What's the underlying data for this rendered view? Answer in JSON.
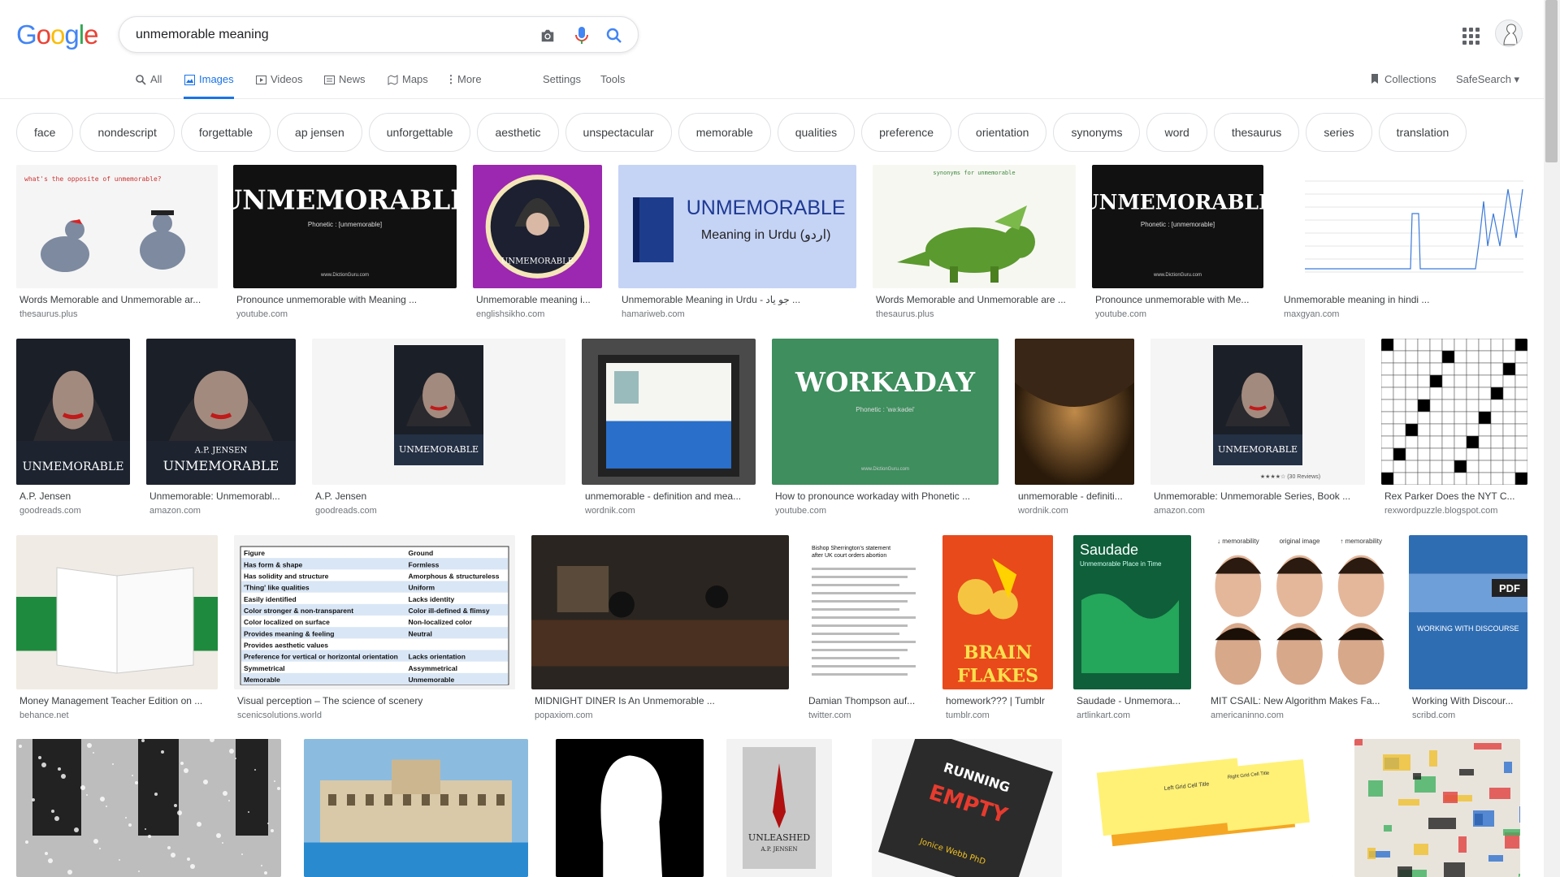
{
  "brand": {
    "letters": [
      "G",
      "o",
      "o",
      "g",
      "l",
      "e"
    ],
    "colors": [
      "#4285f4",
      "#ea4335",
      "#fbbc05",
      "#4285f4",
      "#34a853",
      "#ea4335"
    ]
  },
  "search": {
    "query": "unmemorable meaning",
    "placeholder": "",
    "icons": [
      "camera-icon",
      "microphone-icon",
      "search-icon"
    ]
  },
  "tabs": [
    {
      "label": "All",
      "icon": "search-icon",
      "active": false
    },
    {
      "label": "Images",
      "icon": "image-icon",
      "active": true
    },
    {
      "label": "Videos",
      "icon": "video-icon",
      "active": false
    },
    {
      "label": "News",
      "icon": "news-icon",
      "active": false
    },
    {
      "label": "Maps",
      "icon": "map-icon",
      "active": false
    },
    {
      "label": "More",
      "icon": "more-vert-icon",
      "active": false
    }
  ],
  "tools": {
    "settings": "Settings",
    "tools": "Tools",
    "collections": "Collections",
    "safesearch": "SafeSearch ▾"
  },
  "chips": [
    "face",
    "nondescript",
    "forgettable",
    "ap jensen",
    "unforgettable",
    "aesthetic",
    "unspectacular",
    "memorable",
    "qualities",
    "preference",
    "orientation",
    "synonyms",
    "word",
    "thesaurus",
    "series",
    "translation"
  ],
  "results": [
    {
      "title": "Words Memorable and Unmemorable ar...",
      "source": "thesaurus.plus",
      "thumb": {
        "type": "birds",
        "bg": "#f5f5f5",
        "text": "what's the opposite of unmemorable?"
      }
    },
    {
      "title": "Pronounce unmemorable with Meaning ...",
      "source": "youtube.com",
      "thumb": {
        "type": "title",
        "bg": "#111111",
        "text": "UNMEMORABLE",
        "sub": "Phonetic : [unmemorable]",
        "fg": "#ffffff"
      }
    },
    {
      "title": "Unmemorable meaning i...",
      "source": "englishsikho.com",
      "thumb": {
        "type": "circle",
        "bg": "#9c27b0",
        "text": "UNMEMORABLE"
      }
    },
    {
      "title": "Unmemorable Meaning in Urdu - جو یاد ...",
      "source": "hamariweb.com",
      "thumb": {
        "type": "urdu",
        "bg": "#c5d3f5",
        "text": "UNMEMORABLE",
        "sub": "Meaning in Urdu (اردو)",
        "fg": "#1f3a93"
      }
    },
    {
      "title": "Words Memorable and Unmemorable are ...",
      "source": "thesaurus.plus",
      "thumb": {
        "type": "dino",
        "bg": "#f7f7f2",
        "text": "synonyms for unmemorable"
      }
    },
    {
      "title": "Pronounce unmemorable with Me...",
      "source": "youtube.com",
      "thumb": {
        "type": "title",
        "bg": "#111111",
        "text": "UNMEMORABLE",
        "sub": "Phonetic : [unmemorable]",
        "fg": "#ffffff"
      }
    },
    {
      "title": "Unmemorable meaning in hindi ...",
      "source": "maxgyan.com",
      "thumb": {
        "type": "graph",
        "bg": "#ffffff",
        "text": ""
      }
    },
    {
      "title": "A.P. Jensen",
      "source": "goodreads.com",
      "thumb": {
        "type": "hood",
        "bg": "#1b1f27",
        "text": "UNMEMORABLE"
      }
    },
    {
      "title": "Unmemorable: Unmemorabl...",
      "source": "amazon.com",
      "thumb": {
        "type": "hood",
        "bg": "#1b1f27",
        "text": "UNMEMORABLE",
        "sub": "A.P. JENSEN"
      }
    },
    {
      "title": "A.P. Jensen",
      "source": "goodreads.com",
      "thumb": {
        "type": "hoodsmall",
        "bg": "#f5f5f5",
        "text": "UNMEMORABLE"
      }
    },
    {
      "title": "unmemorable - definition and mea...",
      "source": "wordnik.com",
      "thumb": {
        "type": "atm",
        "bg": "#4a4a4a",
        "text": ""
      }
    },
    {
      "title": "How to pronounce workaday with Phonetic ...",
      "source": "youtube.com",
      "thumb": {
        "type": "title",
        "bg": "#3e8e5e",
        "text": "WORKADAY",
        "sub": "Phonetic : 'wə:kədei'",
        "fg": "#ffffff"
      }
    },
    {
      "title": "unmemorable - definiti...",
      "source": "wordnik.com",
      "thumb": {
        "type": "cave",
        "bg": "#3a2616",
        "text": ""
      }
    },
    {
      "title": "Unmemorable: Unmemorable Series, Book ...",
      "source": "amazon.com",
      "thumb": {
        "type": "hoodsmall",
        "bg": "#f5f5f5",
        "text": "UNMEMORABLE",
        "sub": "★★★★☆ (30 Reviews)"
      }
    },
    {
      "title": "Rex Parker Does the NYT C...",
      "source": "rexwordpuzzle.blogspot.com",
      "thumb": {
        "type": "crossword",
        "bg": "#ffffff",
        "text": ""
      }
    },
    {
      "title": "Money Management Teacher Edition on ...",
      "source": "behance.net",
      "thumb": {
        "type": "book",
        "bg": "#f0ebe4",
        "text": ""
      }
    },
    {
      "title": "Visual perception – The science of scenery",
      "source": "scenicsolutions.world",
      "thumb": {
        "type": "table",
        "bg": "#f3f3f3",
        "rows": [
          [
            "Figure",
            "Ground"
          ],
          [
            "Has form & shape",
            "Formless"
          ],
          [
            "Has solidity and structure",
            "Amorphous & structureless"
          ],
          [
            "'Thing' like qualities",
            "Uniform"
          ],
          [
            "Easily identified",
            "Lacks identity"
          ],
          [
            "Color stronger & non-transparent",
            "Color ill-defined & flimsy"
          ],
          [
            "Color localized on surface",
            "Non-localized color"
          ],
          [
            "Provides meaning & feeling",
            "Neutral"
          ],
          [
            "Provides aesthetic values",
            ""
          ],
          [
            "Preference for vertical or horizontal orientation",
            "Lacks orientation"
          ],
          [
            "Symmetrical",
            "Assymmetrical"
          ],
          [
            "Memorable",
            "Unmemorable"
          ]
        ]
      }
    },
    {
      "title": "MIDNIGHT DINER Is An Unmemorable ...",
      "source": "popaxiom.com",
      "thumb": {
        "type": "diner",
        "bg": "#2a2520",
        "text": ""
      }
    },
    {
      "title": "Damian Thompson auf...",
      "source": "twitter.com",
      "thumb": {
        "type": "article",
        "bg": "#ffffff",
        "text": "Bishop Sherrington's statement after UK court orders abortion"
      }
    },
    {
      "title": "homework??? | Tumblr",
      "source": "tumblr.com",
      "thumb": {
        "type": "flakes",
        "bg": "#e84a1b",
        "text": "BRAIN FLAKES"
      }
    },
    {
      "title": "Saudade - Unmemora...",
      "source": "artlinkart.com",
      "thumb": {
        "type": "saudade",
        "bg": "#0f5f3a",
        "text": "Saudade",
        "sub": "Unmemorable Place in Time"
      }
    },
    {
      "title": "MIT CSAIL: New Algorithm Makes Fa...",
      "source": "americaninno.com",
      "thumb": {
        "type": "faces",
        "bg": "#ffffff",
        "labels": [
          "↓ memorability",
          "original image",
          "↑ memorability"
        ]
      }
    },
    {
      "title": "Working With Discour...",
      "source": "scribd.com",
      "thumb": {
        "type": "pdf",
        "bg": "#2f6db3",
        "text": "WORKING WITH DISCOURSE",
        "sub": "PDF"
      }
    },
    {
      "title": "",
      "source": "",
      "thumb": {
        "type": "rain",
        "bg": "#1a1a1a",
        "text": ""
      }
    },
    {
      "title": "",
      "source": "",
      "thumb": {
        "type": "hotel",
        "bg": "#7fb3d9",
        "text": ""
      }
    },
    {
      "title": "",
      "source": "",
      "thumb": {
        "type": "silhouette",
        "bg": "#000000",
        "text": ""
      }
    },
    {
      "title": "",
      "source": "",
      "thumb": {
        "type": "unleashed",
        "bg": "#dcdcdc",
        "text": "UNLEASHED",
        "sub": "A.P. JENSEN"
      }
    },
    {
      "title": "",
      "source": "",
      "thumb": {
        "type": "running",
        "bg": "#2b2b2b",
        "text": "RUNNING ON EMPTY",
        "sub": "Jonice Webb PhD"
      }
    },
    {
      "title": "",
      "source": "",
      "thumb": {
        "type": "notes",
        "bg": "#ffffff",
        "text": "Left Grid Cell Title",
        "sub": "Right Grid Cell Title"
      }
    },
    {
      "title": "",
      "source": "",
      "thumb": {
        "type": "mural",
        "bg": "#e8e4dc",
        "text": ""
      }
    }
  ]
}
